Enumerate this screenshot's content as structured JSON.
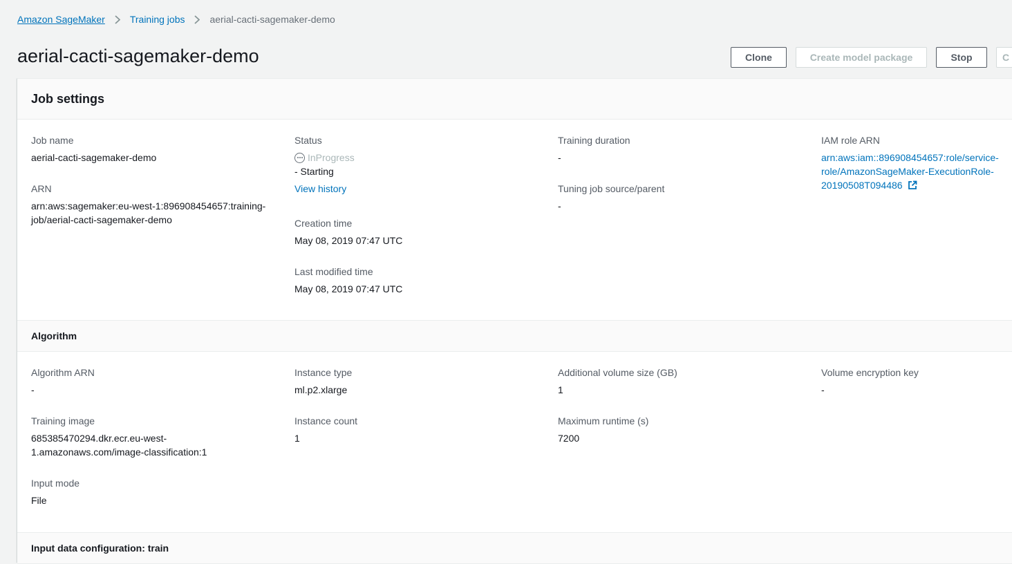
{
  "breadcrumb": {
    "items": [
      "Amazon SageMaker",
      "Training jobs"
    ],
    "current": "aerial-cacti-sagemaker-demo"
  },
  "header": {
    "title": "aerial-cacti-sagemaker-demo",
    "buttons": {
      "clone": "Clone",
      "create_model_package": "Create model package",
      "stop": "Stop",
      "partial": "C"
    }
  },
  "job_settings": {
    "title": "Job settings",
    "job_name_label": "Job name",
    "job_name": "aerial-cacti-sagemaker-demo",
    "arn_label": "ARN",
    "arn_line1": "arn:aws:sagemaker:eu-west-1:896908454657:training-",
    "arn_line2": "job/aerial-cacti-sagemaker-demo",
    "status_label": "Status",
    "status": "InProgress",
    "status_detail": "- Starting",
    "view_history": "View history",
    "creation_time_label": "Creation time",
    "creation_time": "May 08, 2019 07:47 UTC",
    "last_modified_label": "Last modified time",
    "last_modified": "May 08, 2019 07:47 UTC",
    "training_duration_label": "Training duration",
    "training_duration": "-",
    "tuning_job_label": "Tuning job source/parent",
    "tuning_job": "-",
    "iam_role_label": "IAM role ARN",
    "iam_role_line1": "arn:aws:iam::896908454657:role/service-",
    "iam_role_line2": "role/AmazonSageMaker-ExecutionRole-",
    "iam_role_line3": "20190508T094486"
  },
  "algorithm": {
    "title": "Algorithm",
    "algorithm_arn_label": "Algorithm ARN",
    "algorithm_arn": "-",
    "training_image_label": "Training image",
    "training_image_line1": "685385470294.dkr.ecr.eu-west-",
    "training_image_line2": "1.amazonaws.com/image-classification:1",
    "input_mode_label": "Input mode",
    "input_mode": "File",
    "instance_type_label": "Instance type",
    "instance_type": "ml.p2.xlarge",
    "instance_count_label": "Instance count",
    "instance_count": "1",
    "volume_size_label": "Additional volume size (GB)",
    "volume_size": "1",
    "max_runtime_label": "Maximum runtime (s)",
    "max_runtime": "7200",
    "encryption_key_label": "Volume encryption key",
    "encryption_key": "-"
  },
  "input_data": {
    "title": "Input data configuration: train"
  },
  "colors": {
    "link": "#0073bb",
    "label": "#545b64",
    "status_muted": "#aab7b8"
  },
  "icons": {
    "chevron": "chevron-right-icon",
    "status": "status-in-progress-icon",
    "external": "external-link-icon"
  }
}
